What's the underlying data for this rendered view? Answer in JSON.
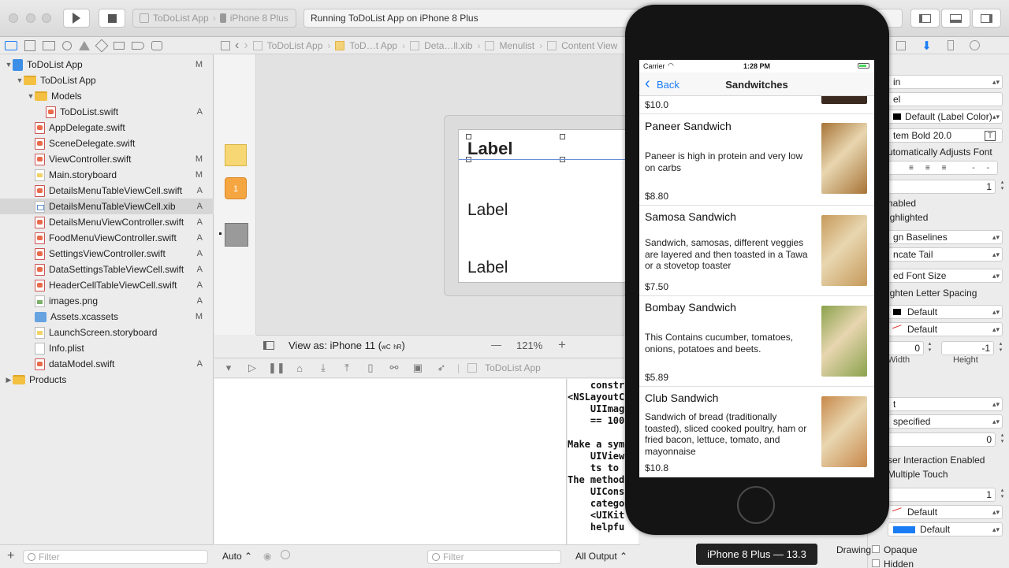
{
  "toolbar": {
    "scheme_app": "ToDoList App",
    "scheme_device": "iPhone 8 Plus",
    "activity": "Running ToDoList App on iPhone 8 Plus"
  },
  "navigator": {
    "items": [
      {
        "label": "ToDoList App",
        "badge": "M"
      },
      {
        "label": "ToDoList App",
        "badge": ""
      },
      {
        "label": "Models",
        "badge": ""
      },
      {
        "label": "ToDoList.swift",
        "badge": "A"
      },
      {
        "label": "AppDelegate.swift",
        "badge": ""
      },
      {
        "label": "SceneDelegate.swift",
        "badge": ""
      },
      {
        "label": "ViewController.swift",
        "badge": "M"
      },
      {
        "label": "Main.storyboard",
        "badge": "M"
      },
      {
        "label": "DetailsMenuTableViewCell.swift",
        "badge": "A"
      },
      {
        "label": "DetailsMenuTableViewCell.xib",
        "badge": "A"
      },
      {
        "label": "DetailsMenuViewController.swift",
        "badge": "A"
      },
      {
        "label": "FoodMenuViewController.swift",
        "badge": "A"
      },
      {
        "label": "SettingsViewController.swift",
        "badge": "A"
      },
      {
        "label": "DataSettingsTableViewCell.swift",
        "badge": "A"
      },
      {
        "label": "HeaderCellTableViewCell.swift",
        "badge": "A"
      },
      {
        "label": "images.png",
        "badge": "A"
      },
      {
        "label": "Assets.xcassets",
        "badge": "M"
      },
      {
        "label": "LaunchScreen.storyboard",
        "badge": ""
      },
      {
        "label": "Info.plist",
        "badge": ""
      },
      {
        "label": "dataModel.swift",
        "badge": "A"
      },
      {
        "label": "Products",
        "badge": ""
      }
    ],
    "filter_placeholder": "Filter"
  },
  "jumpbar": {
    "crumbs": [
      "ToDoList App",
      "ToD…t App",
      "Deta…ll.xib",
      "Menulist",
      "Content View"
    ]
  },
  "canvas": {
    "label1": "Label",
    "label2": "Label",
    "label3": "Label",
    "view_as": "View as: iPhone 11 (",
    "view_as_w": "wC",
    "view_as_h": "hR",
    "view_as_end": ")",
    "zoom": "121%",
    "zoom_out": "—",
    "zoom_in": "+"
  },
  "debug": {
    "process": "ToDoList App",
    "console_lines": [
      "    constr",
      "<NSLayoutC",
      "    UIImag",
      "    == 100",
      "",
      "Make a sym",
      "    UIView",
      "    ts to",
      "The method",
      "    UICons",
      "    catego",
      "    <UIKit",
      "    helpfu"
    ],
    "auto_label": "Auto",
    "filter_placeholder": "Filter",
    "output_label": "All Output"
  },
  "simulator": {
    "carrier": "Carrier",
    "time": "1:28 PM",
    "back": "Back",
    "nav_title": "Sandwitches",
    "prev_price": "$10.0",
    "items": [
      {
        "title": "Paneer Sandwich",
        "desc": "Paneer is high in protein and very low on carbs",
        "price": "$8.80",
        "img_color": "#a77436"
      },
      {
        "title": "Samosa Sandwich",
        "desc": "Sandwich, samosas, different veggies are layered and then toasted in a Tawa or a stovetop toaster",
        "price": "$7.50",
        "img_color": "#c69a5a"
      },
      {
        "title": "Bombay Sandwich",
        "desc": "This Contains cucumber, tomatoes, onions, potatoes and beets.",
        "price": "$5.89",
        "img_color": "#8aa24c"
      },
      {
        "title": "Club Sandwich",
        "desc": "Sandwich of bread (traditionally toasted), sliced cooked poultry, ham or fried bacon, lettuce, tomato, and mayonnaise",
        "price": "$10.8",
        "img_color": "#c8884a"
      }
    ],
    "device_tooltip": "iPhone 8 Plus — 13.3"
  },
  "inspector": {
    "font_style": "in",
    "text": "el",
    "color": "Default (Label Color)",
    "font": "tem Bold 20.0",
    "auto_adjust": "utomatically Adjusts Font",
    "lines": "1",
    "enabled": "nabled",
    "highlighted": "ighlighted",
    "baseline": "gn Baselines",
    "line_break": "ncate Tail",
    "autoshrink": "ed Font Size",
    "tighten": "ighten Letter Spacing",
    "highlight_color": "Default",
    "shadow": "Default",
    "shadow_w": "0",
    "shadow_h": "-1",
    "width_label": "Width",
    "height_label": "Height",
    "mode": "t",
    "semantic": "specified",
    "tag": "0",
    "user_interaction": "ser Interaction Enabled",
    "multiple_touch": "Multiple Touch",
    "alpha": "1",
    "bg": "Default",
    "tint": "Default",
    "drawing": "Drawing",
    "opaque": "Opaque",
    "hidden": "Hidden"
  },
  "colors": {
    "accent": "#1a7cf5",
    "selection": "#d6d6d6",
    "phone_body": "#141414"
  }
}
